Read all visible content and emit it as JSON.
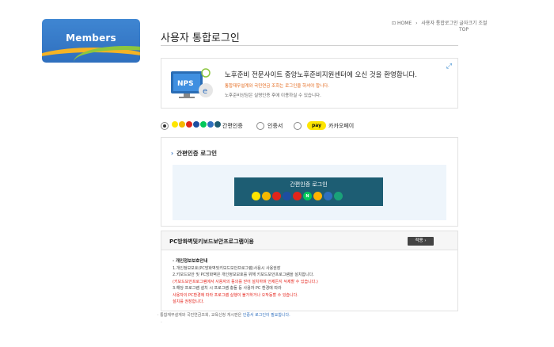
{
  "sidebar": {
    "banner_label": "Members"
  },
  "breadcrumb": {
    "home": "HOME",
    "current": "사용자 통합로그인",
    "extra": "글자크기 조절",
    "top": "TOP"
  },
  "page": {
    "title": "사용자 통합로그인"
  },
  "welcome": {
    "logo_text": "NPS",
    "main": "노후준비 전문사이트 중앙노후준비지원센터에 오신 것을 환영합니다.",
    "sub1": "통합재무설계와 국민연금 조회는 로그인을 하셔야 합니다.",
    "sub2": "노후준비상담은 실명인증 후에 이용하실 수 있습니다."
  },
  "auth_options": [
    {
      "label": "간편인증",
      "checked": true
    },
    {
      "label": "인증서",
      "checked": false
    },
    {
      "label": "카카오페이",
      "checked": false,
      "badge": "pay"
    }
  ],
  "simple_auth": {
    "heading": "간편인증 로그인",
    "banner_title": "간편인증 로그인",
    "providers": [
      {
        "name": "kakao",
        "color": "#fee500",
        "glyph": ""
      },
      {
        "name": "pass",
        "color": "#f5b800",
        "glyph": ""
      },
      {
        "name": "payco",
        "color": "#e1251b",
        "glyph": ""
      },
      {
        "name": "samsung",
        "color": "#1d4ea1",
        "glyph": ""
      },
      {
        "name": "shinhan",
        "color": "#e1251b",
        "glyph": ""
      },
      {
        "name": "naver",
        "color": "#03c75a",
        "glyph": "N"
      },
      {
        "name": "kb",
        "color": "#ffb300",
        "glyph": ""
      },
      {
        "name": "toss",
        "color": "#2f6fbe",
        "glyph": ""
      },
      {
        "name": "banksalad",
        "color": "#1aa179",
        "glyph": ""
      }
    ]
  },
  "keyboard_security": {
    "title": "PC방화벽및키보드보안프로그램이용",
    "apply_label": "적용",
    "body_heading": "· 개인정보보호안내",
    "lines": [
      "1.개인정보보호(PC방화벽및키보드보안프로그램)사용시 사용권장",
      "2.키보드보안 및 PC방화벽은 개인정보보호를 위해 키보드보안프로그램을 설치합니다."
    ],
    "red_line1": "(키보드보안프로그램에서 사용자의 동의를 얻어 설치하며 언제든지 삭제할 수 있습니다.)",
    "line3": "3.해당 프로그램 설치 시 프로그램 충돌 등 사용자 PC 환경에 따라",
    "red_line2": "사용자의 PC환경에 따라 프로그램 실행이 불가하거나 오작동할 수 있습니다.",
    "red_line3": "설치를 권장합니다."
  },
  "footnote": {
    "text": "· 통합재무설계와 국민연금조회, 교육신청 게시판은",
    "link": "인증서 로그인이 필요합니다."
  }
}
